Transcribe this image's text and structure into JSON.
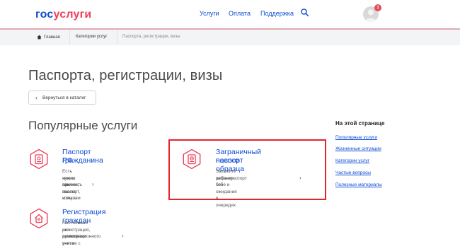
{
  "header": {
    "logo_part1": "гос",
    "logo_part2": "услуги",
    "nav": [
      "Услуги",
      "Оплата",
      "Поддержка"
    ],
    "notification_count": "1"
  },
  "breadcrumb": {
    "home": "Главная",
    "category": "Категории услуг",
    "current": "Паспорта, регистрации, визы"
  },
  "page": {
    "title": "Паспорта, регистрации, визы",
    "back_label": "Вернуться в каталог",
    "section_title": "Популярные услуги"
  },
  "cards": [
    {
      "title_line1": "Паспорт гражданина",
      "title_line2": "РФ",
      "desc_line1": "Есть много причин, по которым",
      "desc_line2": "нужно заменить паспорт, и мы о",
      "desc_line3": "них знаем",
      "arrow": "›"
    },
    {
      "title_line1": "Заграничный паспорт",
      "title_line2": "нового образца",
      "desc_line1": "Закажите загранпаспорт себе и",
      "desc_line2": "ребенку без ожидания в очередях",
      "arrow": "›"
    },
    {
      "title_line1": "Регистрация граждан",
      "desc_line1": "Постоянная или временная",
      "desc_line2": "регистрация, а также снятие с",
      "desc_line3": "регистрационного учета",
      "arrow": "›"
    }
  ],
  "sidebar": {
    "title": "На этой странице",
    "links": [
      "Популярные услуги",
      "Жизненные ситуации",
      "Категории услуг",
      "Частые вопросы",
      "Полезные материалы"
    ]
  },
  "colors": {
    "brand_blue": "#0d4cd3",
    "brand_red": "#ee3f58",
    "highlight_red": "#e3242b"
  }
}
